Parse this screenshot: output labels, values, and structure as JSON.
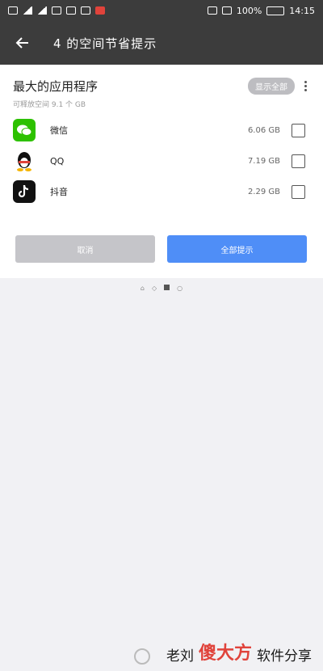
{
  "status_bar": {
    "icons": [
      "sim-icon",
      "signal-icon",
      "signal-icon",
      "wifi-icon",
      "notification-icon",
      "notification-icon",
      "notification-icon"
    ],
    "battery": "100%",
    "time": "14:15"
  },
  "app_bar": {
    "title": "4 的空间节省提示"
  },
  "section": {
    "title": "最大的应用程序",
    "subtitle": "可释放空间 9.1 个 GB",
    "pill_label": "显示全部",
    "apps": [
      {
        "name": "微信",
        "size": "6.06 GB",
        "icon": "wechat-icon"
      },
      {
        "name": "QQ",
        "size": "7.19 GB",
        "icon": "qq-icon"
      },
      {
        "name": "抖音",
        "size": "2.29 GB",
        "icon": "douyin-icon"
      }
    ]
  },
  "buttons": {
    "cancel": "取消",
    "remind": "全部提示"
  },
  "pager": {
    "labels": [
      "⌂",
      "◇",
      "○"
    ]
  },
  "watermark": {
    "part1": "老刘",
    "red": "傻大方",
    "part2": "软件分享"
  },
  "colors": {
    "header": "#3c3c3c",
    "accent": "#4f8ef7",
    "wechat": "#2dc100"
  }
}
